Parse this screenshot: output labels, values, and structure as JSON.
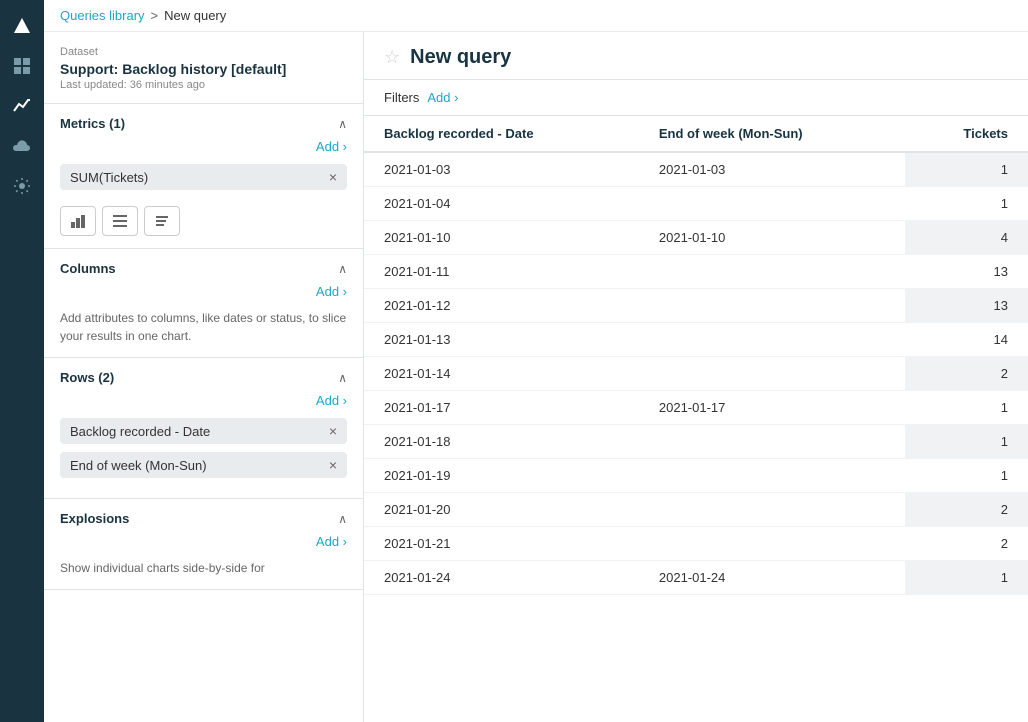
{
  "breadcrumb": {
    "library_label": "Queries library",
    "separator": ">",
    "current_label": "New query"
  },
  "query": {
    "title": "New query",
    "star_icon": "☆"
  },
  "dataset": {
    "label": "Dataset",
    "name": "Support: Backlog history [default]",
    "updated": "Last updated: 36 minutes ago"
  },
  "metrics": {
    "title": "Metrics (1)",
    "add_label": "Add ›",
    "chip": "SUM(Tickets)"
  },
  "chart_icons": [
    {
      "icon": "⬜",
      "name": "bar-chart-icon"
    },
    {
      "icon": "≡",
      "name": "table-chart-icon"
    },
    {
      "icon": "💬",
      "name": "text-chart-icon"
    }
  ],
  "columns": {
    "title": "Columns",
    "add_label": "Add ›",
    "hint": "Add attributes to columns, like dates or status, to slice your results in one chart."
  },
  "rows": {
    "title": "Rows (2)",
    "add_label": "Add ›",
    "chips": [
      "Backlog recorded - Date",
      "End of week (Mon-Sun)"
    ]
  },
  "explosions": {
    "title": "Explosions",
    "add_label": "Add ›",
    "hint": "Show individual charts side-by-side for"
  },
  "filters": {
    "label": "Filters",
    "add_label": "Add ›"
  },
  "table": {
    "columns": [
      {
        "label": "Backlog recorded - Date",
        "key": "date",
        "type": "text"
      },
      {
        "label": "End of week (Mon-Sun)",
        "key": "week",
        "type": "text"
      },
      {
        "label": "Tickets",
        "key": "tickets",
        "type": "num"
      }
    ],
    "rows": [
      {
        "date": "2021-01-03",
        "week": "2021-01-03",
        "tickets": 1,
        "shaded": true
      },
      {
        "date": "2021-01-04",
        "week": "",
        "tickets": 1,
        "shaded": false
      },
      {
        "date": "2021-01-10",
        "week": "2021-01-10",
        "tickets": 4,
        "shaded": true
      },
      {
        "date": "2021-01-11",
        "week": "",
        "tickets": 13,
        "shaded": false
      },
      {
        "date": "2021-01-12",
        "week": "",
        "tickets": 13,
        "shaded": true
      },
      {
        "date": "2021-01-13",
        "week": "",
        "tickets": 14,
        "shaded": false
      },
      {
        "date": "2021-01-14",
        "week": "",
        "tickets": 2,
        "shaded": true
      },
      {
        "date": "2021-01-17",
        "week": "2021-01-17",
        "tickets": 1,
        "shaded": false
      },
      {
        "date": "2021-01-18",
        "week": "",
        "tickets": 1,
        "shaded": true
      },
      {
        "date": "2021-01-19",
        "week": "",
        "tickets": 1,
        "shaded": false
      },
      {
        "date": "2021-01-20",
        "week": "",
        "tickets": 2,
        "shaded": true
      },
      {
        "date": "2021-01-21",
        "week": "",
        "tickets": 2,
        "shaded": false
      },
      {
        "date": "2021-01-24",
        "week": "2021-01-24",
        "tickets": 1,
        "shaded": true
      }
    ]
  },
  "nav": {
    "icons": [
      {
        "name": "logo-icon",
        "symbol": "▲",
        "active": true
      },
      {
        "name": "grid-icon",
        "symbol": "⊞",
        "active": false
      },
      {
        "name": "chart-nav-icon",
        "symbol": "📈",
        "active": true
      },
      {
        "name": "cloud-icon",
        "symbol": "☁",
        "active": false
      },
      {
        "name": "settings-icon",
        "symbol": "⚙",
        "active": false
      }
    ]
  }
}
